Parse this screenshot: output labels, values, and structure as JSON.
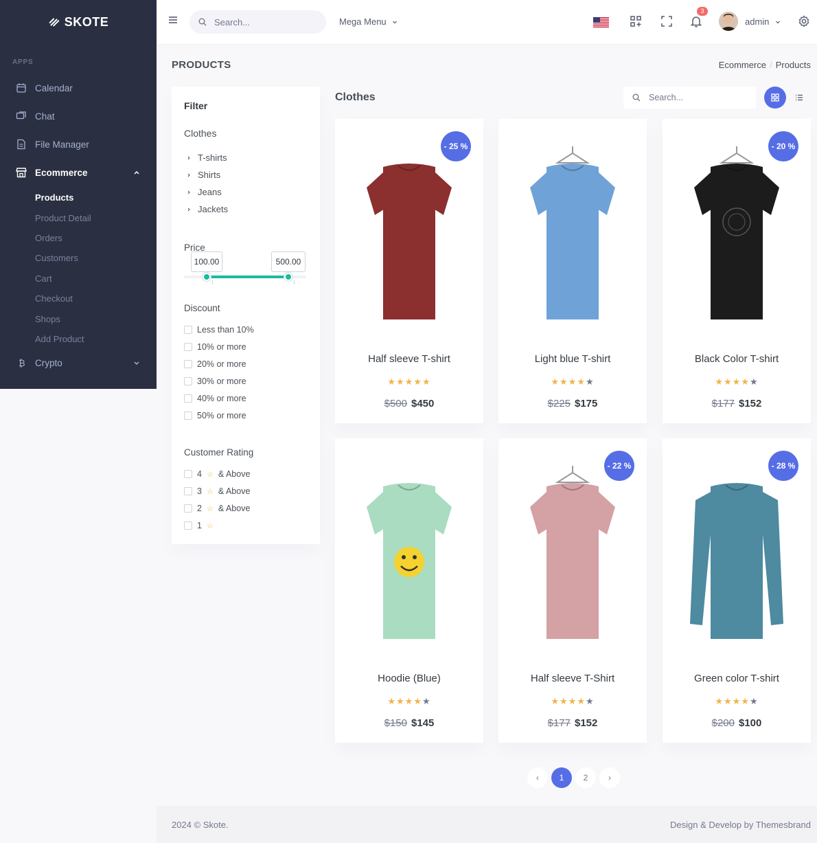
{
  "brand": {
    "name": "SKOTE"
  },
  "sidebar": {
    "section_title": "APPS",
    "items": [
      {
        "label": "Calendar",
        "icon": "calendar-icon"
      },
      {
        "label": "Chat",
        "icon": "chat-icon"
      },
      {
        "label": "File Manager",
        "icon": "file-icon"
      },
      {
        "label": "Ecommerce",
        "icon": "store-icon",
        "expanded": true
      },
      {
        "label": "Crypto",
        "icon": "bitcoin-icon"
      }
    ],
    "ecommerce_sub": [
      "Products",
      "Product Detail",
      "Orders",
      "Customers",
      "Cart",
      "Checkout",
      "Shops",
      "Add Product"
    ]
  },
  "topbar": {
    "search_placeholder": "Search...",
    "mega_menu": "Mega Menu",
    "notification_count": "3",
    "username": "admin"
  },
  "page": {
    "title": "PRODUCTS",
    "breadcrumb": [
      "Ecommerce",
      "Products"
    ]
  },
  "filter": {
    "title": "Filter",
    "category_title": "Clothes",
    "categories": [
      "T-shirts",
      "Shirts",
      "Jeans",
      "Jackets"
    ],
    "price_title": "Price",
    "price_min": "100.00",
    "price_max": "500.00",
    "discount_title": "Discount",
    "discounts": [
      "Less than 10%",
      "10% or more",
      "20% or more",
      "30% or more",
      "40% or more",
      "50% or more"
    ],
    "rating_title": "Customer Rating",
    "ratings": [
      {
        "num": "4",
        "suffix": "& Above"
      },
      {
        "num": "3",
        "suffix": "& Above"
      },
      {
        "num": "2",
        "suffix": "& Above"
      },
      {
        "num": "1",
        "suffix": ""
      }
    ]
  },
  "products_section": {
    "title": "Clothes",
    "search_placeholder": "Search..."
  },
  "products": [
    {
      "name": "Half sleeve T-shirt",
      "old": "$500",
      "new": "$450",
      "discount": "- 25 %",
      "rating": 5,
      "color": "#8b2f2f"
    },
    {
      "name": "Light blue T-shirt",
      "old": "$225",
      "new": "$175",
      "discount": "",
      "rating": 4,
      "color": "#6fa3d8"
    },
    {
      "name": "Black Color T-shirt",
      "old": "$177",
      "new": "$152",
      "discount": "- 20 %",
      "rating": 4,
      "color": "#1c1c1c"
    },
    {
      "name": "Hoodie (Blue)",
      "old": "$150",
      "new": "$145",
      "discount": "",
      "rating": 4,
      "color": "#a9dcc0"
    },
    {
      "name": "Half sleeve T-Shirt",
      "old": "$177",
      "new": "$152",
      "discount": "- 22 %",
      "rating": 4,
      "color": "#d4a1a4"
    },
    {
      "name": "Green color T-shirt",
      "old": "$200",
      "new": "$100",
      "discount": "- 28 %",
      "rating": 4,
      "color": "#4e8aa0"
    }
  ],
  "pagination": {
    "prev": "‹",
    "pages": [
      "1",
      "2"
    ],
    "next": "›",
    "active": "1"
  },
  "footer": {
    "left": "2024 © Skote.",
    "right": "Design & Develop by Themesbrand"
  },
  "colors": {
    "primary": "#556ee6",
    "sidebar": "#2a3042",
    "star": "#f1b44c",
    "slider": "#1abc9c"
  }
}
